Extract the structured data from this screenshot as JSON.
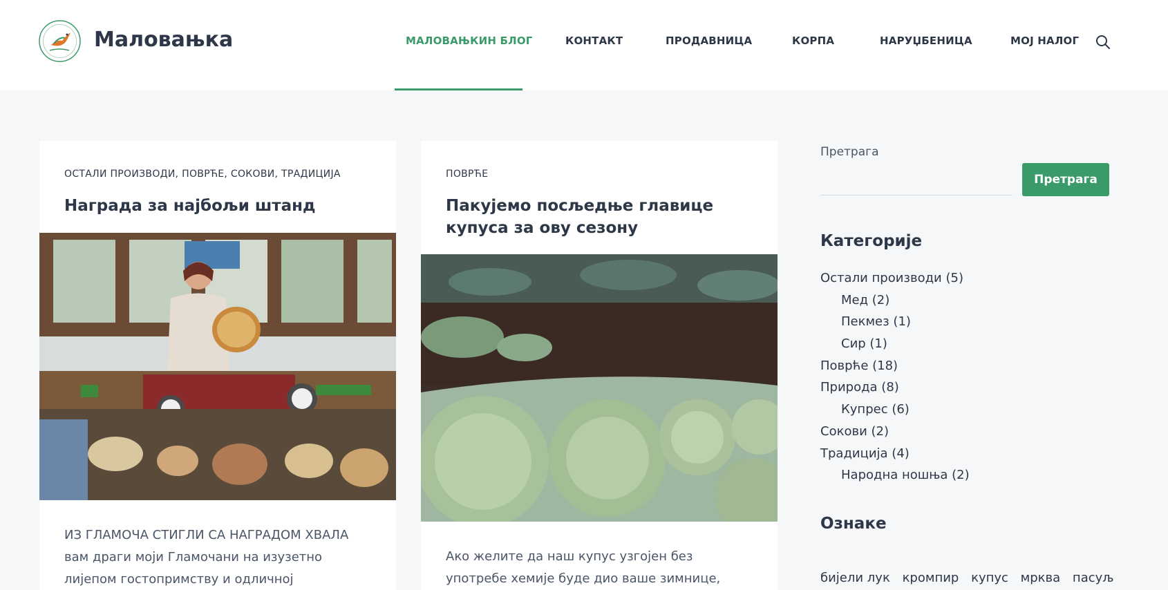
{
  "site": {
    "title": "Маловањка",
    "logo_icon": "bird-logo-icon"
  },
  "nav": {
    "items": [
      {
        "label": "МАЛОВАЊКИН БЛОГ",
        "active": true
      },
      {
        "label": "КОНТАКТ"
      },
      {
        "label": "ПРОДАВНИЦА"
      },
      {
        "label": "КОРПА"
      },
      {
        "label": "НАРУЏБЕНИЦА"
      },
      {
        "label": "МОЈ НАЛОГ"
      }
    ],
    "search_icon": "search-icon"
  },
  "posts": [
    {
      "categories": "ОСТАЛИ ПРОИЗВОДИ, ПОВРЋЕ, СОКОВИ, ТРАДИЦИЈА",
      "title": "Награда за најбољи штанд",
      "excerpt": "ИЗ ГЛАМОЧА СТИГЛИ СА НАГРАДОМ ХВАЛА вам драги моји Гламочани на изузетно лијепом гостопримству и одличној организацији"
    },
    {
      "categories": "ПОВРЋЕ",
      "title": "Пакујемо посљедње главице купуса за ову сезону",
      "excerpt": "Ако желите да наш купус узгојен без употребе хемије буде дио ваше зимнице, можете се јавити"
    }
  ],
  "sidebar": {
    "search_label": "Претрага",
    "search_value": "",
    "search_button": "Претрага",
    "categories_heading": "Категорије",
    "categories": [
      {
        "label": "Остали производи (5)",
        "sub": false
      },
      {
        "label": "Мед (2)",
        "sub": true
      },
      {
        "label": "Пекмез (1)",
        "sub": true
      },
      {
        "label": "Сир (1)",
        "sub": true
      },
      {
        "label": "Поврће (18)",
        "sub": false
      },
      {
        "label": "Природа (8)",
        "sub": false
      },
      {
        "label": "Купрес (6)",
        "sub": true
      },
      {
        "label": "Сокови (2)",
        "sub": false
      },
      {
        "label": "Традиција (4)",
        "sub": false
      },
      {
        "label": "Народна ношња (2)",
        "sub": true
      }
    ],
    "tags_heading": "Ознаке",
    "tags": [
      "бијели лук",
      "кромпир",
      "купус",
      "мрква",
      "пасуљ"
    ]
  },
  "colors": {
    "accent": "#3b9a6a",
    "text": "#2d3748",
    "background": "#f5f7f9"
  }
}
